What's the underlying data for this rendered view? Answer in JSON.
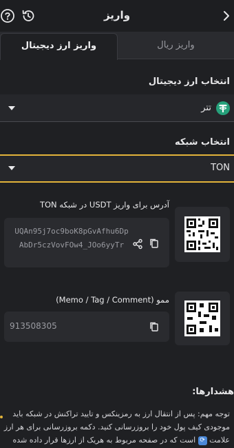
{
  "header": {
    "title": "واریز",
    "help_icon": "help-circle-icon",
    "history_icon": "history-icon",
    "back_icon": "chevron-right-icon"
  },
  "tabs": [
    {
      "label": "واریز ریال",
      "active": false
    },
    {
      "label": "واریز ارز دیجیتال",
      "active": true
    }
  ],
  "coin_select": {
    "label": "انتخاب ارز دیجیتال",
    "value": "تتر",
    "icon": "tether-icon"
  },
  "network_select": {
    "label": "انتخاب شبکه",
    "value": "TON"
  },
  "address_card": {
    "label": "آدرس برای واریز USDT در شبکه TON",
    "address": "UQAn95j7oc9boK8pGvAfhu6DpAbDr5czVovFOw4_JOo6yyTr",
    "qr_icon": "qr-code-icon"
  },
  "memo_card": {
    "label": "ممو (Memo / Tag / Comment)",
    "value": "913508305",
    "qr_icon": "qr-code-icon"
  },
  "warnings": {
    "title": "هشدارها:",
    "text_before": "توجه مهم: پس از انتقال ارز به رمزینکس و تایید تراکنش در شبکه باید موجودی کیف پول خود را بروزرسانی کنید. دکمه بروزرسانی برای هر ارز علامت",
    "text_after": "است که در صفحه مربوط به هریک از ارزها قرار داده شده"
  },
  "colors": {
    "accent": "#e3b43a",
    "tether": "#26a17b",
    "background": "#1f2023"
  }
}
